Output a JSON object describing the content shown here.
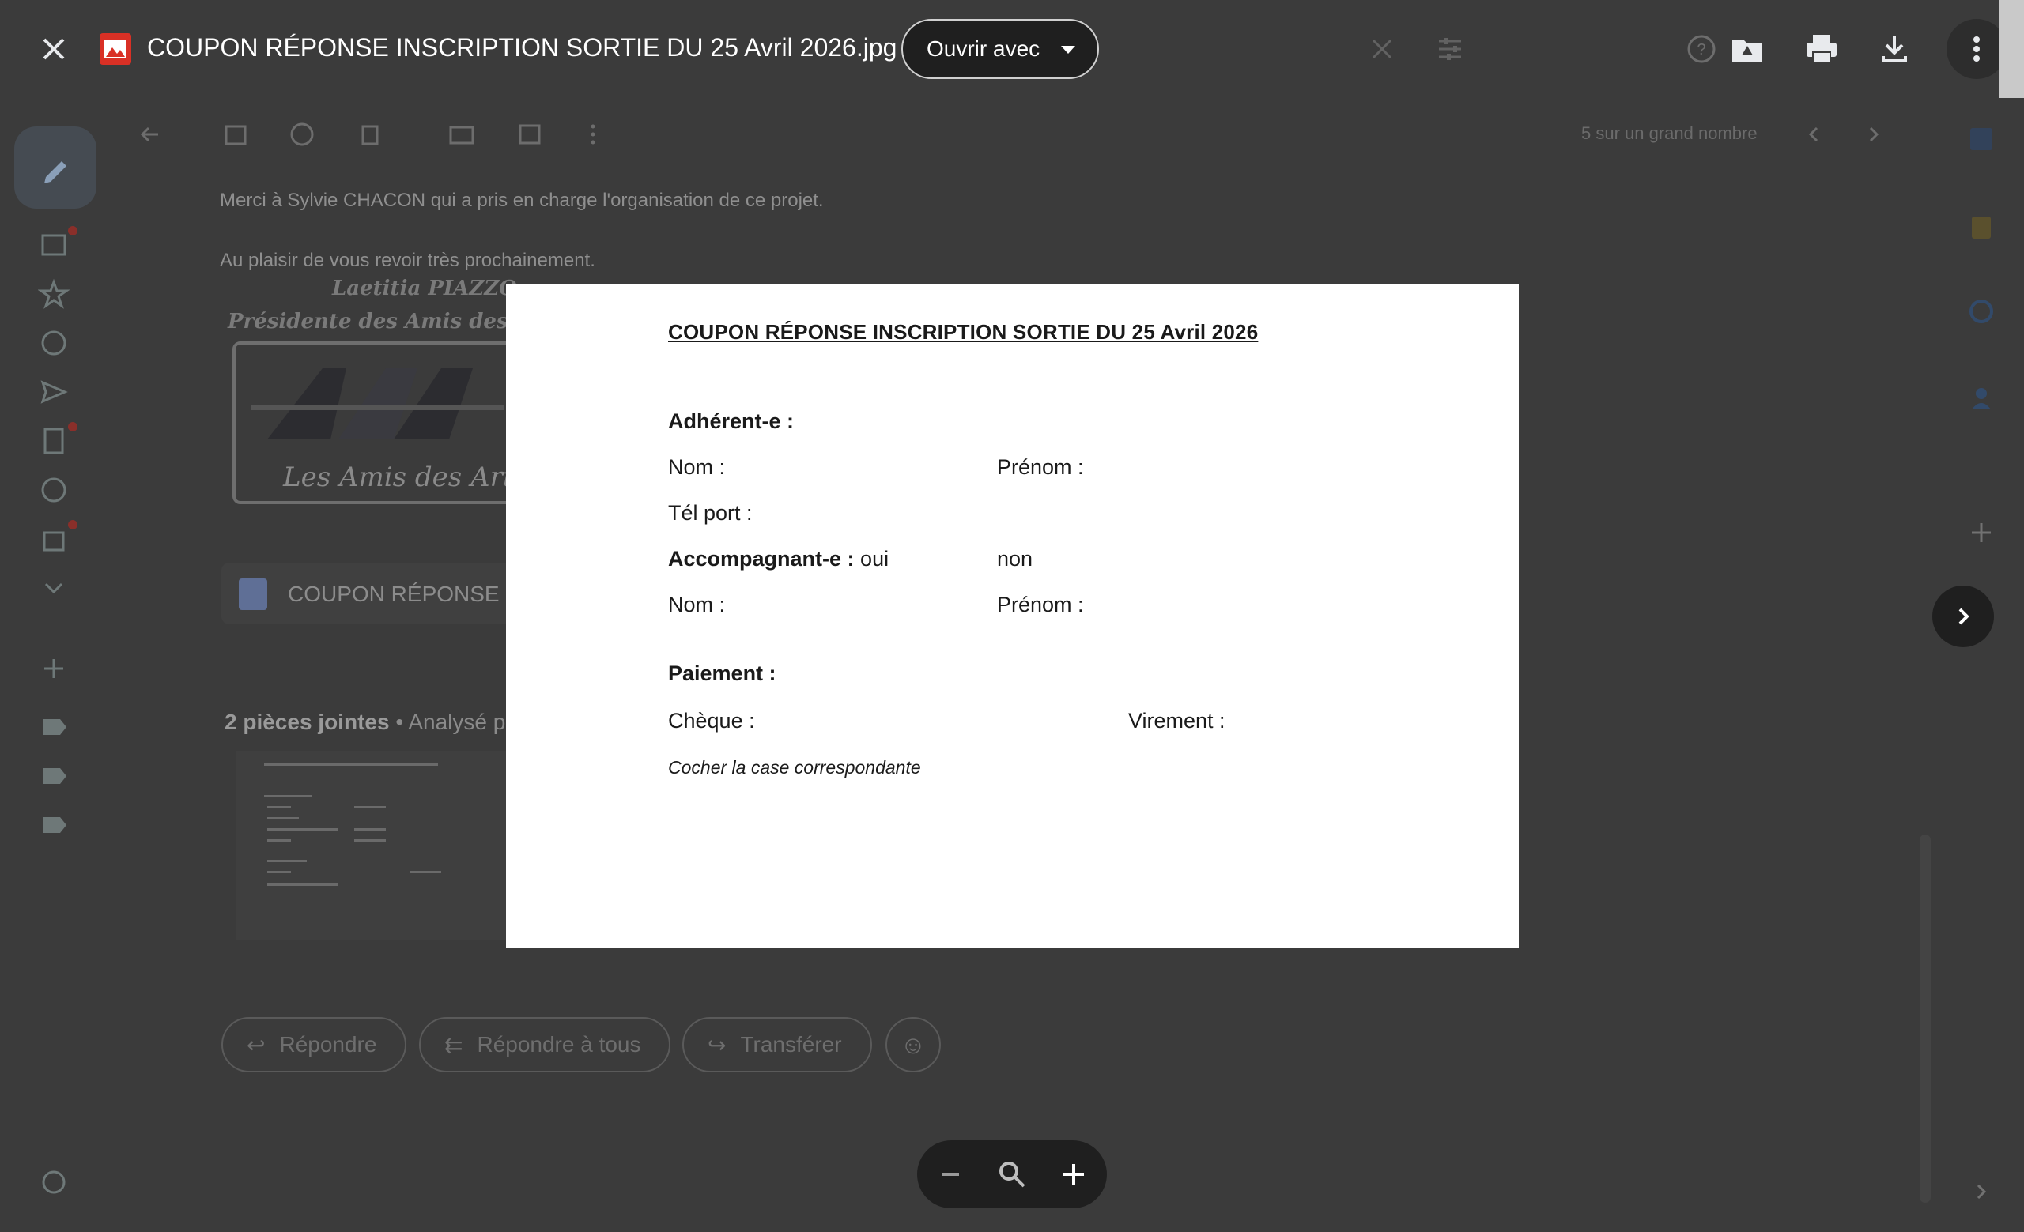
{
  "viewer": {
    "file_name": "COUPON RÉPONSE INSCRIPTION SORTIE DU 25 Avril 2026.jpg",
    "open_with_label": "Ouvrir avec",
    "icons": [
      "close-icon",
      "image-file-icon",
      "help-icon",
      "add-to-drive-icon",
      "print-icon",
      "download-icon",
      "more-vert-icon",
      "chevron-right-icon",
      "zoom-out-icon",
      "zoom-reset-icon",
      "zoom-in-icon"
    ]
  },
  "document": {
    "title": "COUPON RÉPONSE INSCRIPTION SORTIE DU 25 Avril 2026",
    "adherent_heading": "Adhérent-e :",
    "nom_label": "Nom :",
    "prenom_label": "Prénom :",
    "tel_label": "Tél port :",
    "accompagnant_heading": "Accompagnant-e :",
    "oui": "oui",
    "non": "non",
    "nom2_label": "Nom :",
    "prenom2_label": "Prénom :",
    "paiement_heading": "Paiement :",
    "cheque_label": "Chèque :",
    "virement_label": "Virement :",
    "note": "Cocher la case correspondante"
  },
  "background_mail": {
    "line1": "Merci à Sylvie CHACON qui a pris en charge l'organisation de ce projet.",
    "line2": "Au plaisir de vous revoir très prochainement.",
    "signature_name": "Laetitia PIAZZO",
    "signature_role": "Présidente des Amis des Arts",
    "logo_caption": "Les Amis des Arts d",
    "attachment_chip": "COUPON RÉPONSE IN",
    "attachments_count": "2 pièces jointes",
    "attachments_suffix": "• Analysé p",
    "pager": "5 sur un grand nombre",
    "reply": "Répondre",
    "reply_all": "Répondre à tous",
    "forward": "Transférer"
  }
}
